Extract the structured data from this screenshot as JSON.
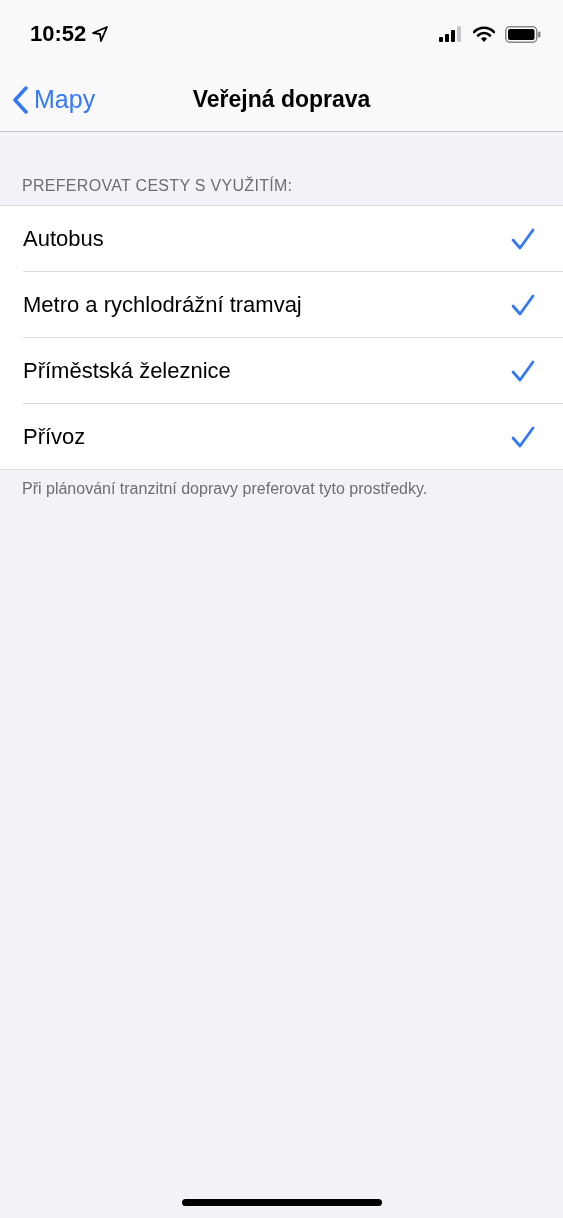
{
  "status_bar": {
    "time": "10:52"
  },
  "nav": {
    "back": "Mapy",
    "title": "Veřejná doprava"
  },
  "section": {
    "header": "PREFEROVAT CESTY S VYUŽITÍM:",
    "items": [
      {
        "label": "Autobus",
        "checked": true
      },
      {
        "label": "Metro a rychlodrážní tramvaj",
        "checked": true
      },
      {
        "label": "Příměstská železnice",
        "checked": true
      },
      {
        "label": "Přívoz",
        "checked": true
      }
    ],
    "footer": "Při plánování tranzitní dopravy preferovat tyto prostředky."
  }
}
